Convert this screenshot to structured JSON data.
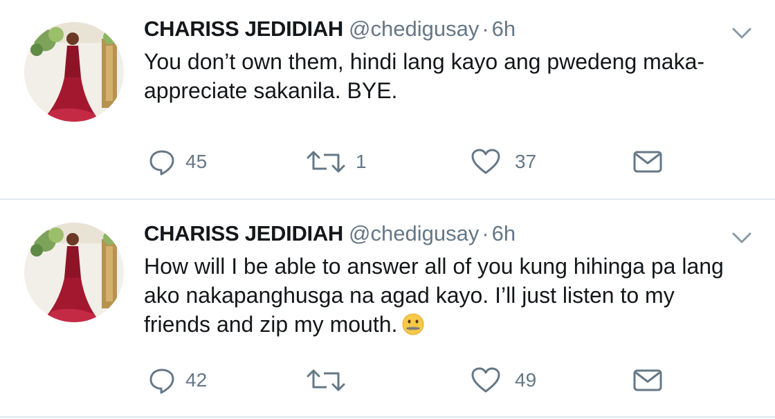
{
  "tweets": [
    {
      "name": "CHARISS JEDIDIAH",
      "handle": "@chedigusay",
      "separator": "·",
      "time": "6h",
      "text": "You don’t own them, hindi lang kayo ang pwedeng maka-appreciate sakanila. BYE.",
      "emoji": "",
      "replies": "45",
      "retweets": "1",
      "likes": "37"
    },
    {
      "name": "CHARISS JEDIDIAH",
      "handle": "@chedigusay",
      "separator": "·",
      "time": "6h",
      "text": "How will I be able to answer all of you kung hihinga pa lang ako nakapanghusga na agad kayo. I’ll just listen to my friends and zip my mouth.",
      "emoji": "🤐",
      "replies": "42",
      "retweets": "",
      "likes": "49"
    }
  ],
  "icons": {
    "reply": "reply-icon",
    "retweet": "retweet-icon",
    "like": "heart-icon",
    "dm": "envelope-icon",
    "menu": "chevron-down-icon"
  },
  "colors": {
    "text": "#14171a",
    "secondary": "#657786",
    "divider": "#e1e8ed"
  }
}
